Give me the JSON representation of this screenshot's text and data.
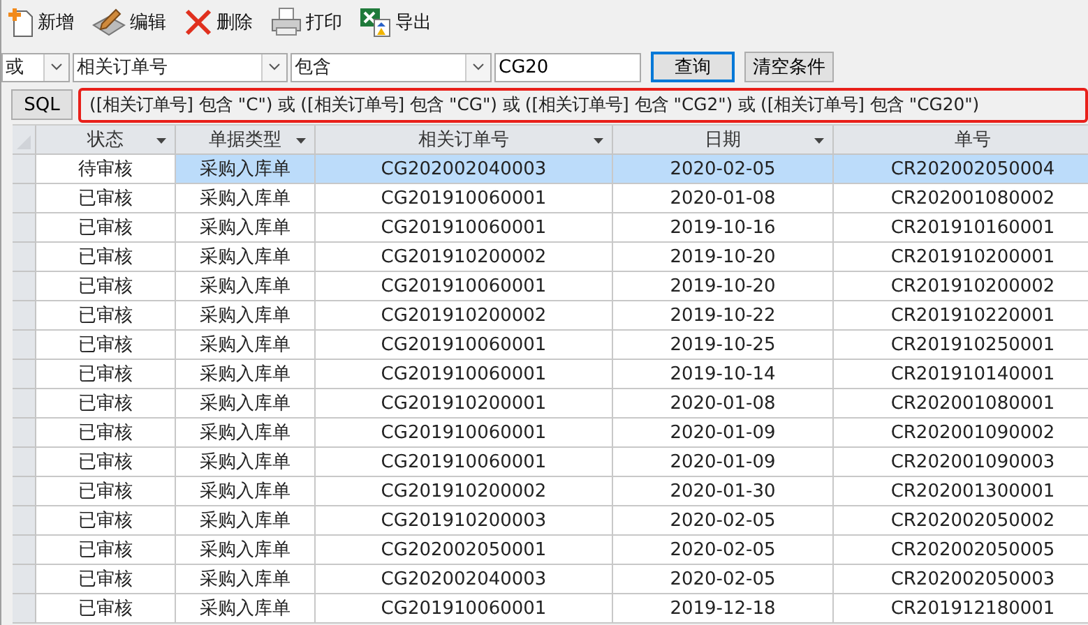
{
  "toolbar": [
    {
      "label": "新增",
      "kind": "new"
    },
    {
      "label": "编辑",
      "kind": "edit"
    },
    {
      "label": "删除",
      "kind": "delete"
    },
    {
      "label": "打印",
      "kind": "print"
    },
    {
      "label": "导出",
      "kind": "export"
    }
  ],
  "filter": {
    "logic": "或",
    "field": "相关订单号",
    "operator": "包含",
    "value": "CG20",
    "buttons": [
      {
        "label": "查询",
        "focused": true
      },
      {
        "label": "清空条件",
        "focused": false
      }
    ]
  },
  "sql": {
    "button": "SQL",
    "expression": "([相关订单号] 包含 \"C\") 或 ([相关订单号] 包含 \"CG\") 或 ([相关订单号] 包含 \"CG2\") 或 ([相关订单号] 包含 \"CG20\")"
  },
  "table": {
    "columns": [
      "状态",
      "单据类型",
      "相关订单号",
      "日期",
      "单号"
    ],
    "rows": [
      {
        "selected": true,
        "cells": [
          "待审核",
          "采购入库单",
          "CG202002040003",
          "2020-02-05",
          "CR202002050004"
        ]
      },
      {
        "selected": false,
        "cells": [
          "已审核",
          "采购入库单",
          "CG201910060001",
          "2020-01-08",
          "CR202001080002"
        ]
      },
      {
        "selected": false,
        "cells": [
          "已审核",
          "采购入库单",
          "CG201910060001",
          "2019-10-16",
          "CR201910160001"
        ]
      },
      {
        "selected": false,
        "cells": [
          "已审核",
          "采购入库单",
          "CG201910200002",
          "2019-10-20",
          "CR201910200001"
        ]
      },
      {
        "selected": false,
        "cells": [
          "已审核",
          "采购入库单",
          "CG201910060001",
          "2019-10-20",
          "CR201910200002"
        ]
      },
      {
        "selected": false,
        "cells": [
          "已审核",
          "采购入库单",
          "CG201910200002",
          "2019-10-22",
          "CR201910220001"
        ]
      },
      {
        "selected": false,
        "cells": [
          "已审核",
          "采购入库单",
          "CG201910060001",
          "2019-10-25",
          "CR201910250001"
        ]
      },
      {
        "selected": false,
        "cells": [
          "已审核",
          "采购入库单",
          "CG201910060001",
          "2019-10-14",
          "CR201910140001"
        ]
      },
      {
        "selected": false,
        "cells": [
          "已审核",
          "采购入库单",
          "CG201910200001",
          "2020-01-08",
          "CR202001080001"
        ]
      },
      {
        "selected": false,
        "cells": [
          "已审核",
          "采购入库单",
          "CG201910060001",
          "2020-01-09",
          "CR202001090002"
        ]
      },
      {
        "selected": false,
        "cells": [
          "已审核",
          "采购入库单",
          "CG201910060001",
          "2020-01-09",
          "CR202001090003"
        ]
      },
      {
        "selected": false,
        "cells": [
          "已审核",
          "采购入库单",
          "CG201910200002",
          "2020-01-30",
          "CR202001300001"
        ]
      },
      {
        "selected": false,
        "cells": [
          "已审核",
          "采购入库单",
          "CG201910200003",
          "2020-02-05",
          "CR202002050002"
        ]
      },
      {
        "selected": false,
        "cells": [
          "已审核",
          "采购入库单",
          "CG202002050001",
          "2020-02-05",
          "CR202002050005"
        ]
      },
      {
        "selected": false,
        "cells": [
          "已审核",
          "采购入库单",
          "CG202002040003",
          "2020-02-05",
          "CR202002050003"
        ]
      },
      {
        "selected": false,
        "cells": [
          "已审核",
          "采购入库单",
          "CG201910060001",
          "2019-12-18",
          "CR201912180001"
        ]
      }
    ]
  }
}
